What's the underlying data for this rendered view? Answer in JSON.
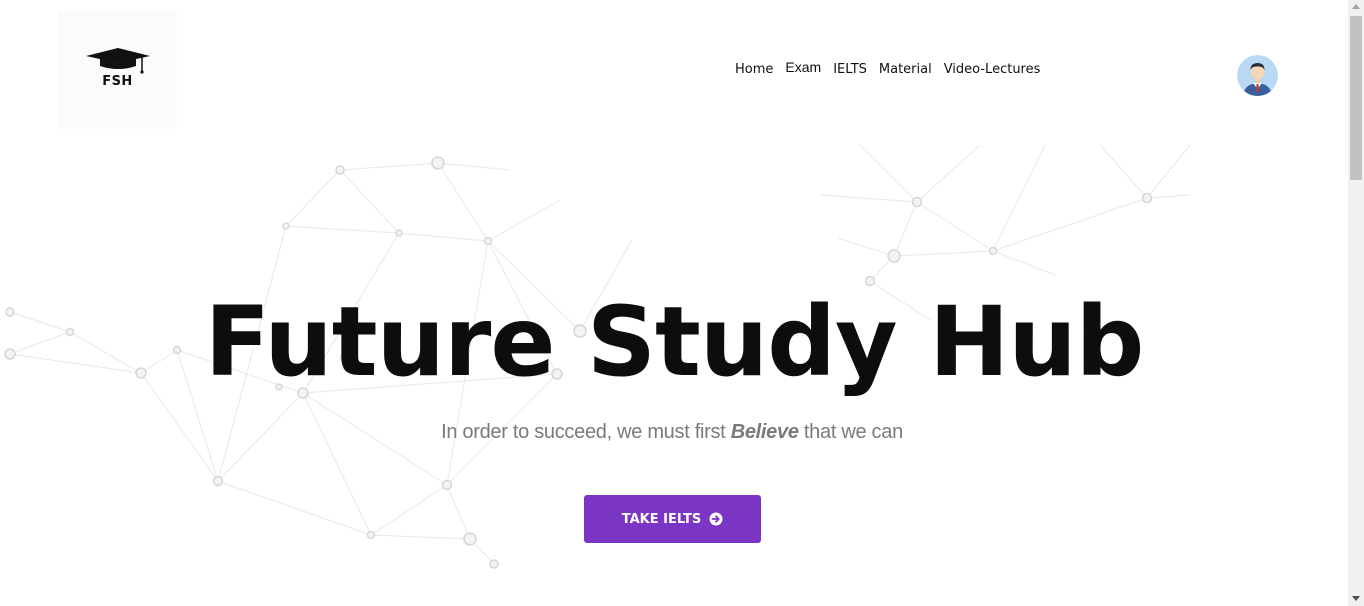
{
  "brand": {
    "logo_text": "FSH"
  },
  "nav": {
    "items": [
      {
        "label": "Home"
      },
      {
        "label": "Exam"
      },
      {
        "label": "IELTS"
      },
      {
        "label": "Material"
      },
      {
        "label": "Video-Lectures"
      }
    ]
  },
  "hero": {
    "title": "Future Study Hub",
    "subtitle_before": "In order to succeed, we must first ",
    "subtitle_emphasis": "Believe",
    "subtitle_after": " that we can",
    "cta_label": "TAKE IELTS"
  },
  "icons": {
    "logo": "graduation-cap-icon",
    "avatar": "user-avatar-icon",
    "cta": "arrow-circle-right-icon"
  },
  "colors": {
    "accent": "#7b35c4",
    "title": "#0d0d0d",
    "subtitle": "#7a7a7a",
    "background": "#ffffff"
  }
}
